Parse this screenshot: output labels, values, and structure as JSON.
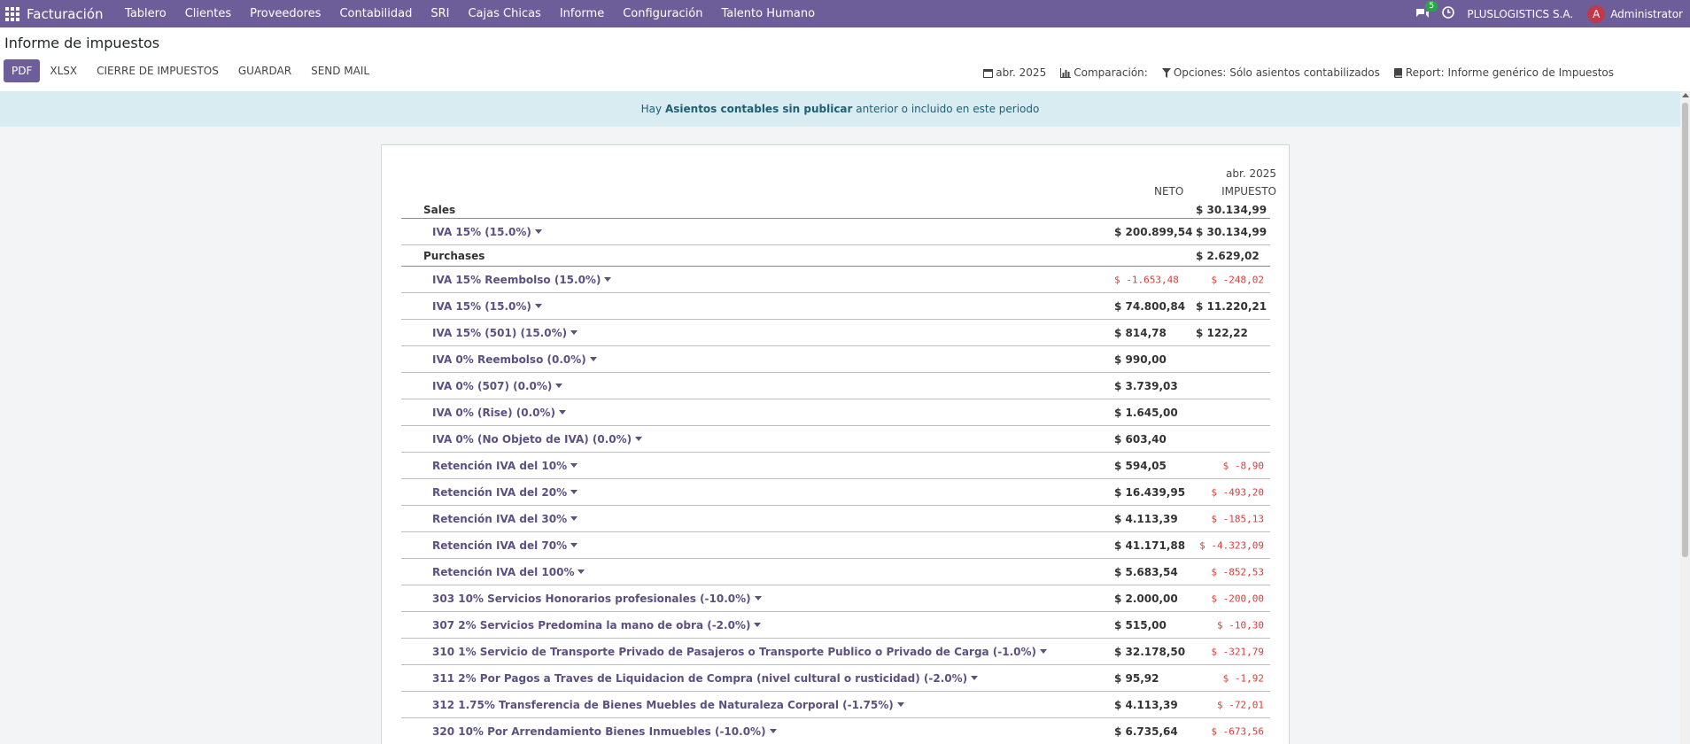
{
  "topbar": {
    "app_title": "Facturación",
    "menu": [
      "Tablero",
      "Clientes",
      "Proveedores",
      "Contabilidad",
      "SRI",
      "Cajas Chicas",
      "Informe",
      "Configuración",
      "Talento Humano"
    ],
    "chat_badge": "5",
    "company": "PLUSLOGISTICS S.A.",
    "avatar_letter": "A",
    "user": "Administrator"
  },
  "page": {
    "title": "Informe de impuestos",
    "buttons": {
      "pdf": "PDF",
      "xlsx": "XLSX",
      "cierre": "CIERRE DE IMPUESTOS",
      "guardar": "GUARDAR",
      "send_mail": "SEND MAIL"
    },
    "filters": {
      "period": "abr. 2025",
      "comparison": "Comparación:",
      "options": "Opciones: Sólo asientos contabilizados",
      "report": "Report: Informe genérico de Impuestos"
    }
  },
  "alert": {
    "prefix": "Hay",
    "bold": "Asientos contables sin publicar",
    "suffix": "anterior o incluido en este periodo"
  },
  "report": {
    "period": "abr. 2025",
    "col_neto": "NETO",
    "col_impuesto": "IMPUESTO",
    "rows": [
      {
        "type": "section",
        "name": "Sales",
        "neto": "",
        "imp": "$ 30.134,99",
        "h": 20
      },
      {
        "type": "line",
        "name": "IVA 15% (15.0%)",
        "neto": "$ 200.899,54",
        "imp": "$ 30.134,99",
        "h": 30
      },
      {
        "type": "section",
        "name": "Purchases",
        "neto": "",
        "imp": "$ 2.629,02",
        "h": 24
      },
      {
        "type": "line",
        "name": "IVA 15% Reembolso (15.0%)",
        "neto": "$ -1.653,48",
        "imp": "$ -248,02",
        "neg_neto": true,
        "neg_imp": true,
        "h": 30
      },
      {
        "type": "line",
        "name": "IVA 15% (15.0%)",
        "neto": "$ 74.800,84",
        "imp": "$ 11.220,21",
        "h": 30
      },
      {
        "type": "line",
        "name": "IVA 15% (501) (15.0%)",
        "neto": "$ 814,78",
        "imp": "$ 122,22",
        "h": 30
      },
      {
        "type": "line",
        "name": "IVA 0% Reembolso (0.0%)",
        "neto": "$ 990,00",
        "imp": "",
        "h": 30
      },
      {
        "type": "line",
        "name": "IVA 0% (507) (0.0%)",
        "neto": "$ 3.739,03",
        "imp": "",
        "h": 30
      },
      {
        "type": "line",
        "name": "IVA 0% (Rise) (0.0%)",
        "neto": "$ 1.645,00",
        "imp": "",
        "h": 30
      },
      {
        "type": "line",
        "name": "IVA 0% (No Objeto de IVA) (0.0%)",
        "neto": "$ 603,40",
        "imp": "",
        "h": 30
      },
      {
        "type": "line",
        "name": "Retención IVA del 10%",
        "neto": "$ 594,05",
        "imp": "$ -8,90",
        "neg_imp": true,
        "h": 30
      },
      {
        "type": "line",
        "name": "Retención IVA del 20%",
        "neto": "$ 16.439,95",
        "imp": "$ -493,20",
        "neg_imp": true,
        "h": 30
      },
      {
        "type": "line",
        "name": "Retención IVA del 30%",
        "neto": "$ 4.113,39",
        "imp": "$ -185,13",
        "neg_imp": true,
        "h": 30
      },
      {
        "type": "line",
        "name": "Retención IVA del 70%",
        "neto": "$ 41.171,88",
        "imp": "$ -4.323,09",
        "neg_imp": true,
        "h": 30
      },
      {
        "type": "line",
        "name": "Retención IVA del 100%",
        "neto": "$ 5.683,54",
        "imp": "$ -852,53",
        "neg_imp": true,
        "h": 30
      },
      {
        "type": "line",
        "name": "303 10% Servicios Honorarios profesionales (-10.0%)",
        "neto": "$ 2.000,00",
        "imp": "$ -200,00",
        "neg_imp": true,
        "h": 30
      },
      {
        "type": "line",
        "name": "307 2% Servicios Predomina la mano de obra (-2.0%)",
        "neto": "$ 515,00",
        "imp": "$ -10,30",
        "neg_imp": true,
        "h": 30
      },
      {
        "type": "line",
        "name": "310 1% Servicio de Transporte Privado de Pasajeros o Transporte Publico o Privado de Carga (-1.0%)",
        "neto": "$ 32.178,50",
        "imp": "$ -321,79",
        "neg_imp": true,
        "h": 30
      },
      {
        "type": "line",
        "name": "311 2% Por Pagos a Traves de Liquidacion de Compra (nivel cultural o rusticidad) (-2.0%)",
        "neto": "$ 95,92",
        "imp": "$ -1,92",
        "neg_imp": true,
        "h": 30
      },
      {
        "type": "line",
        "name": "312 1.75% Transferencia de Bienes Muebles de Naturaleza Corporal (-1.75%)",
        "neto": "$ 4.113,39",
        "imp": "$ -72,01",
        "neg_imp": true,
        "h": 30
      },
      {
        "type": "line",
        "name": "320 10% Por Arrendamiento Bienes Inmuebles (-10.0%)",
        "neto": "$ 6.735,64",
        "imp": "$ -673,56",
        "neg_imp": true,
        "h": 30
      }
    ]
  }
}
